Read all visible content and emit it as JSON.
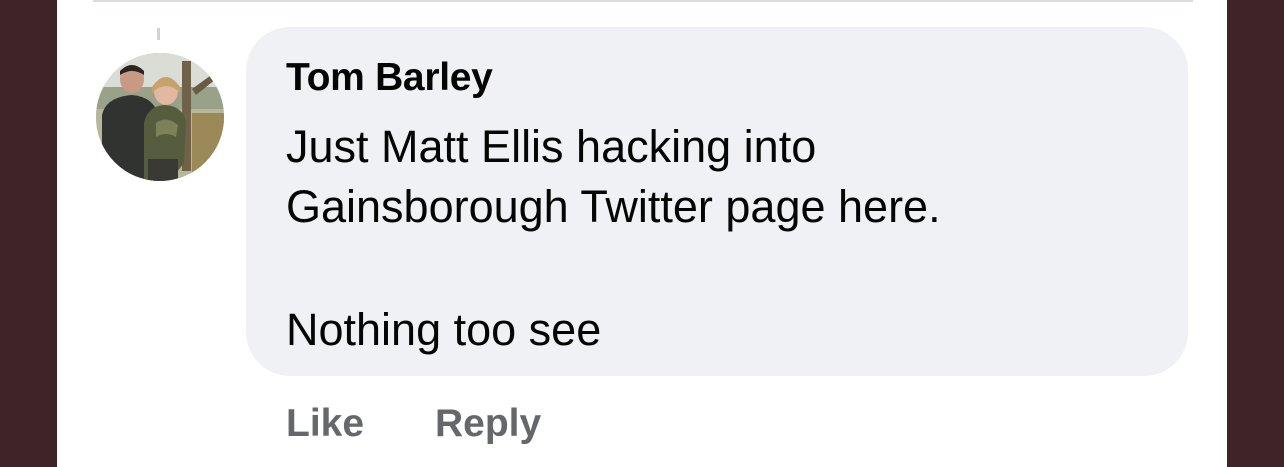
{
  "comment": {
    "author": "Tom Barley",
    "lines": [
      "Just Matt Ellis hacking into",
      "Gainsborough Twitter page here.",
      "Nothing too see"
    ]
  },
  "actions": {
    "like_label": "Like",
    "reply_label": "Reply"
  },
  "colors": {
    "outer_background": "#3f2329",
    "panel_background": "#ffffff",
    "bubble_background": "#f0f1f5",
    "text": "#050505",
    "action_text": "#65676b"
  },
  "icons": {
    "avatar": "profile-photo"
  }
}
